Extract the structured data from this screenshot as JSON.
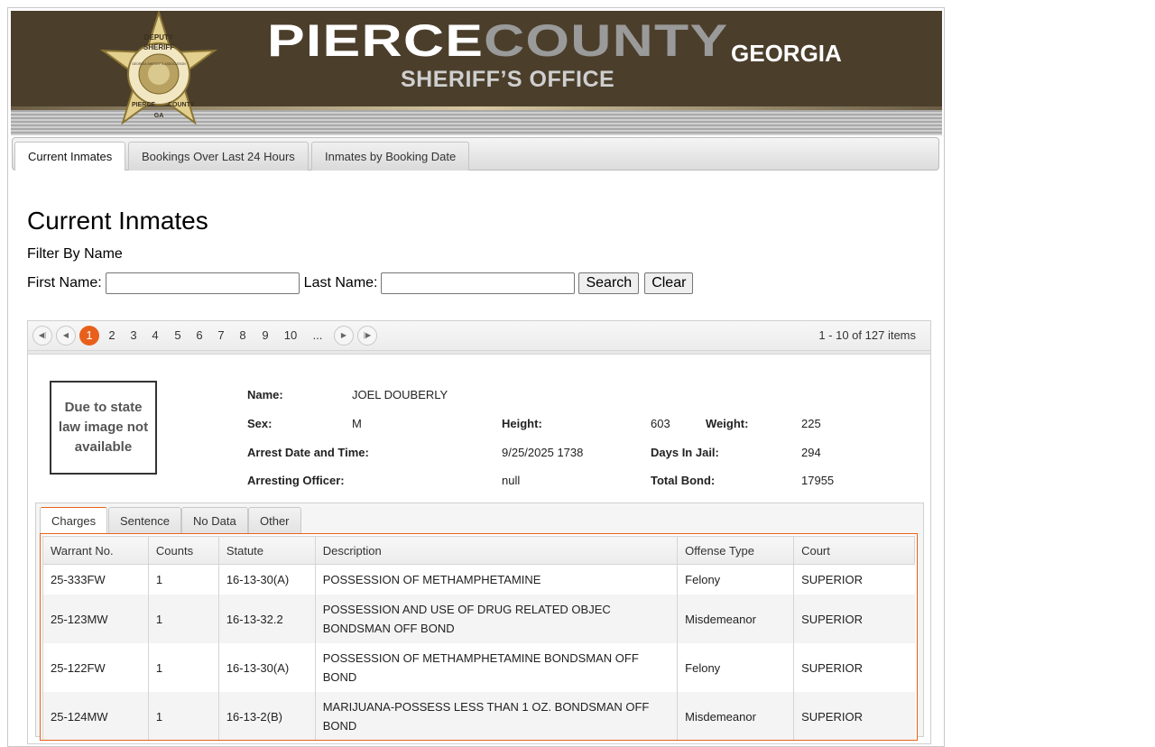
{
  "banner": {
    "name_part1": "PIERCE",
    "name_part2": "COUNTY",
    "state": "GEORGIA",
    "subtitle": "SHERIFF’S OFFICE",
    "badge_top": "DEPUTY",
    "badge_mid": "SHERIFF",
    "badge_ring": "GEORGIA SHERIFF'S ASSOCIATION",
    "badge_left": "PIERCE",
    "badge_center": "GA",
    "badge_right": "COUNTY"
  },
  "tabs": [
    {
      "label": "Current Inmates",
      "active": true
    },
    {
      "label": "Bookings Over Last 24 Hours",
      "active": false
    },
    {
      "label": "Inmates by Booking Date",
      "active": false
    }
  ],
  "page_title": "Current Inmates",
  "filter": {
    "heading": "Filter By Name",
    "first_label": "First Name:",
    "first_value": "",
    "last_label": "Last Name:",
    "last_value": "",
    "search_label": "Search",
    "clear_label": "Clear"
  },
  "pager": {
    "pages": [
      "1",
      "2",
      "3",
      "4",
      "5",
      "6",
      "7",
      "8",
      "9",
      "10",
      "..."
    ],
    "current": "1",
    "info": "1 - 10 of 127 items",
    "icons": [
      "first-page-icon",
      "prev-page-icon",
      "next-page-icon",
      "last-page-icon"
    ]
  },
  "inmate": {
    "photo_text": "Due to state law image not available",
    "name_label": "Name:",
    "name": "JOEL DOUBERLY",
    "sex_label": "Sex:",
    "sex": "M",
    "height_label": "Height:",
    "height": "603",
    "weight_label": "Weight:",
    "weight": "225",
    "arrest_label": "Arrest Date and Time:",
    "arrest": "9/25/2025 1738",
    "days_label": "Days In Jail:",
    "days": "294",
    "officer_label": "Arresting Officer:",
    "officer": "null",
    "bond_label": "Total Bond:",
    "bond": "17955"
  },
  "detail_tabs": [
    "Charges",
    "Sentence",
    "No Data",
    "Other"
  ],
  "charges": {
    "columns": [
      "Warrant No.",
      "Counts",
      "Statute",
      "Description",
      "Offense Type",
      "Court"
    ],
    "rows": [
      [
        "25-333FW",
        "1",
        "16-13-30(A)",
        "POSSESSION OF METHAMPHETAMINE",
        "Felony",
        "SUPERIOR"
      ],
      [
        "25-123MW",
        "1",
        "16-13-32.2",
        "POSSESSION AND USE OF DRUG RELATED OBJEC BONDSMAN OFF BOND",
        "Misdemeanor",
        "SUPERIOR"
      ],
      [
        "25-122FW",
        "1",
        "16-13-30(A)",
        "POSSESSION OF METHAMPHETAMINE BONDSMAN OFF BOND",
        "Felony",
        "SUPERIOR"
      ],
      [
        "25-124MW",
        "1",
        "16-13-2(B)",
        "MARIJUANA-POSSESS LESS THAN 1 OZ. BONDSMAN OFF BOND",
        "Misdemeanor",
        "SUPERIOR"
      ]
    ]
  },
  "colors": {
    "accent": "#e8601c",
    "banner": "#4b3f2c"
  }
}
